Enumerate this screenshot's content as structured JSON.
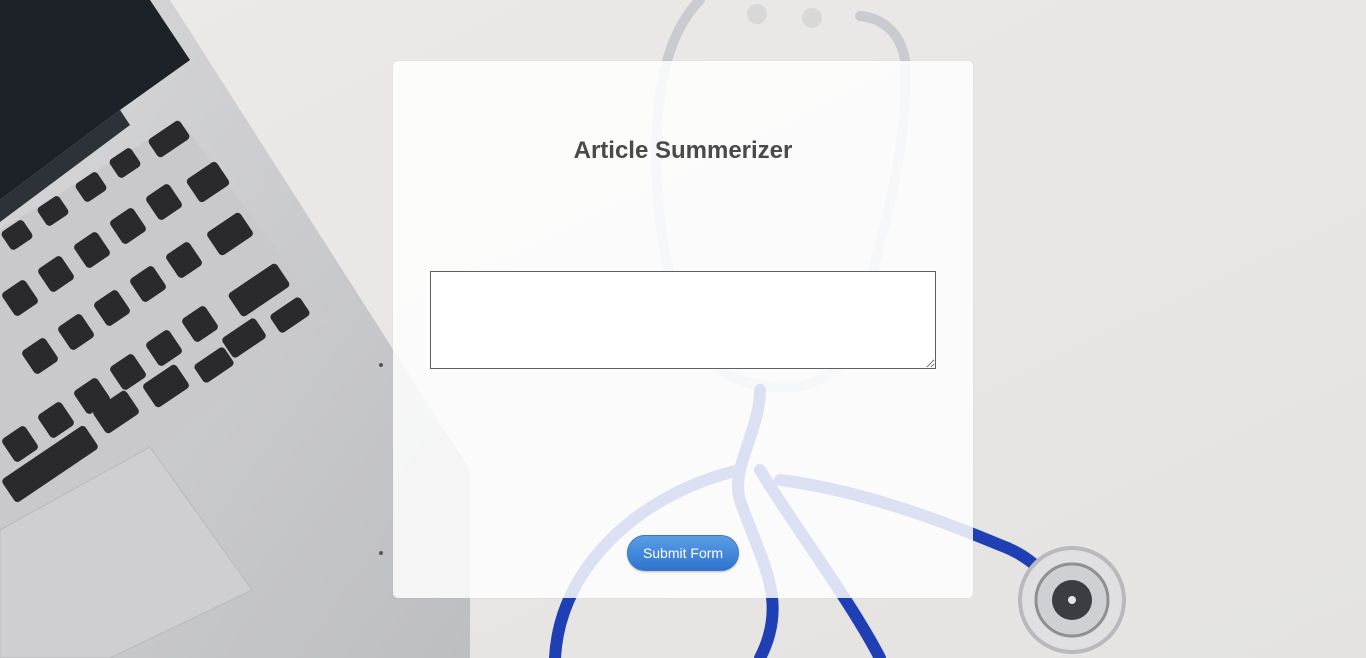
{
  "page": {
    "title": "Article Summerizer"
  },
  "form": {
    "textarea_value": "",
    "textarea_placeholder": "",
    "submit_label": "Submit Form"
  },
  "colors": {
    "background": "#e7e6e4",
    "card": "#ffffff",
    "title_text": "#4a4a4a",
    "button_top": "#5a9ee6",
    "button_bottom": "#2e74cf",
    "stethoscope_blue": "#1f3fb5"
  },
  "icons": {
    "laptop": "laptop-photo",
    "stethoscope": "stethoscope-photo"
  }
}
